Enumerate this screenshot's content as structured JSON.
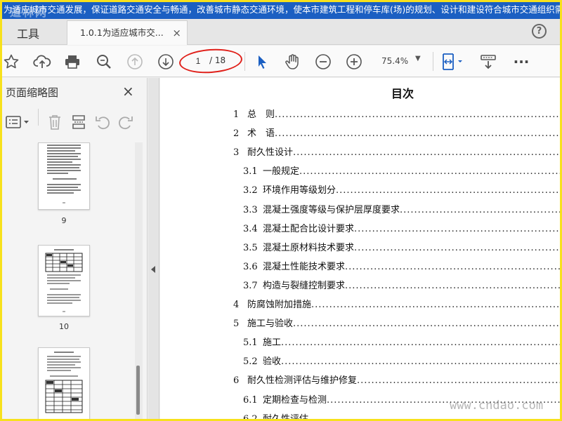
{
  "banner": {
    "text": "为适应城市交通发展，保证道路交通安全与畅通，改善城市静态交通环境，使本市建筑工程和停车库(场)的规划、设计和建设符合城市交通组织需要和管",
    "watermark": "道林网"
  },
  "tabs": {
    "tools_label": "工具",
    "doc_label": "1.0.1为适应城市交...",
    "close_glyph": "×",
    "help_glyph": "?"
  },
  "toolbar": {
    "page_current": "1",
    "page_total": "/ 18",
    "zoom": "75.4%",
    "zoom_arrow": "▼",
    "more": "···"
  },
  "left_panel": {
    "title": "页面缩略图",
    "close_glyph": "×",
    "thumbnails": [
      {
        "page": "9"
      },
      {
        "page": "10"
      }
    ]
  },
  "document": {
    "title": "目次",
    "toc": [
      {
        "num": "1",
        "text": "总　则"
      },
      {
        "num": "2",
        "text": "术　语"
      },
      {
        "num": "3",
        "text": "耐久性设计"
      },
      {
        "num": "3.1",
        "text": "一般规定"
      },
      {
        "num": "3.2",
        "text": "环境作用等级划分"
      },
      {
        "num": "3.3",
        "text": "混凝土强度等级与保护层厚度要求"
      },
      {
        "num": "3.4",
        "text": "混凝土配合比设计要求"
      },
      {
        "num": "3.5",
        "text": "混凝土原材料技术要求"
      },
      {
        "num": "3.6",
        "text": "混凝土性能技术要求"
      },
      {
        "num": "3.7",
        "text": "构造与裂缝控制要求"
      },
      {
        "num": "4",
        "text": "防腐蚀附加措施"
      },
      {
        "num": "5",
        "text": "施工与验收"
      },
      {
        "num": "5.1",
        "text": "施工"
      },
      {
        "num": "5.2",
        "text": "验收"
      },
      {
        "num": "6",
        "text": "耐久性检测评估与维护修复"
      },
      {
        "num": "6.1",
        "text": "定期检查与检测"
      },
      {
        "num": "6.2",
        "text": "耐久性评估"
      }
    ]
  },
  "watermark_bottom": "www.cndao.com",
  "colors": {
    "banner_bg": "#1b5fc2",
    "frame": "#f7e11c",
    "annotation_ellipse": "#e0201a",
    "cursor_blue": "#1b5fc2"
  }
}
